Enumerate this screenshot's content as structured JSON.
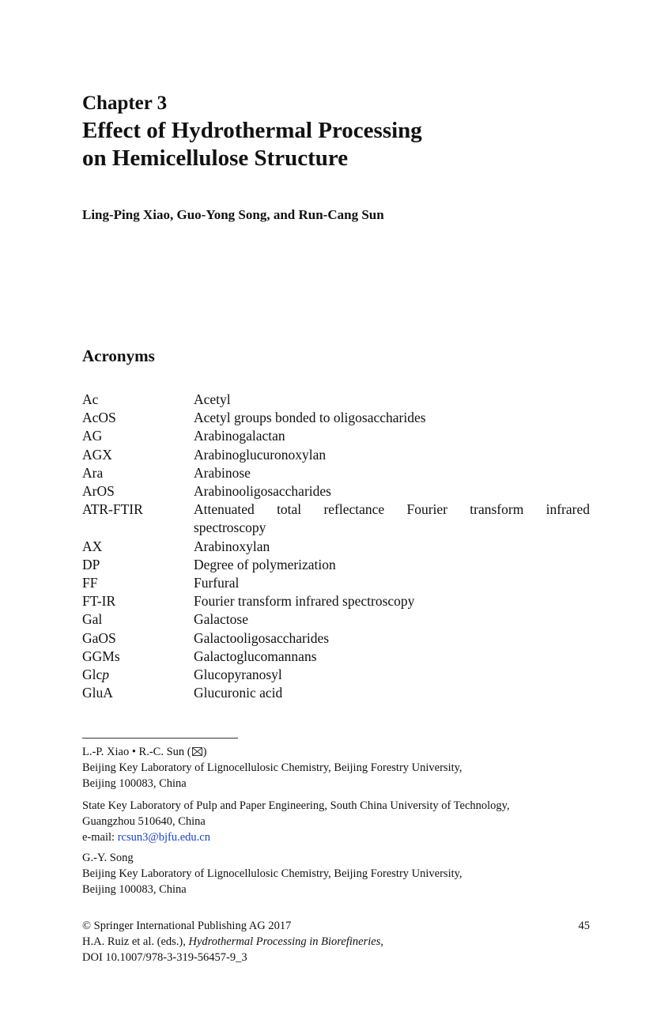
{
  "chapter": {
    "label": "Chapter 3",
    "title_line1": "Effect of Hydrothermal Processing",
    "title_line2": "on Hemicellulose Structure",
    "authors": "Ling-Ping Xiao, Guo-Yong Song, and Run-Cang Sun"
  },
  "acronyms": {
    "heading": "Acronyms",
    "items": [
      {
        "abbr": "Ac",
        "def": "Acetyl"
      },
      {
        "abbr": "AcOS",
        "def": "Acetyl groups bonded to oligosaccharides"
      },
      {
        "abbr": "AG",
        "def": "Arabinogalactan"
      },
      {
        "abbr": "AGX",
        "def": "Arabinoglucuronoxylan"
      },
      {
        "abbr": "Ara",
        "def": "Arabinose"
      },
      {
        "abbr": "ArOS",
        "def": "Arabinooligosaccharides"
      },
      {
        "abbr": "ATR-FTIR",
        "def_line1": "Attenuated total reflectance Fourier transform infrared",
        "def_line2": "spectroscopy"
      },
      {
        "abbr": "AX",
        "def": "Arabinoxylan"
      },
      {
        "abbr": "DP",
        "def": "Degree of polymerization"
      },
      {
        "abbr": "FF",
        "def": "Furfural"
      },
      {
        "abbr": "FT-IR",
        "def": "Fourier transform infrared spectroscopy"
      },
      {
        "abbr": "Gal",
        "def": "Galactose"
      },
      {
        "abbr": "GaOS",
        "def": "Galactooligosaccharides"
      },
      {
        "abbr": "GGMs",
        "def": "Galactoglucomannans"
      },
      {
        "abbr_prefix": "Glc",
        "abbr_italic": "p",
        "def": "Glucopyranosyl"
      },
      {
        "abbr": "GluA",
        "def": "Glucuronic acid"
      }
    ]
  },
  "affiliations": {
    "block1": {
      "names": "L.-P. Xiao • R.-C. Sun (",
      "names_close": ")",
      "line1": "Beijing Key Laboratory of Lignocellulosic Chemistry, Beijing Forestry University,",
      "line2": "Beijing 100083, China"
    },
    "block2": {
      "line1": "State Key Laboratory of Pulp and Paper Engineering, South China University of Technology,",
      "line2": "Guangzhou 510640, China",
      "email_label": "e-mail: ",
      "email": "rcsun3@bjfu.edu.cn"
    },
    "block3": {
      "names": "G.-Y. Song",
      "line1": "Beijing Key Laboratory of Lignocellulosic Chemistry, Beijing Forestry University,",
      "line2": "Beijing 100083, China"
    }
  },
  "footer": {
    "copyright": "© Springer International Publishing AG 2017",
    "page_number": "45",
    "citation_prefix": "H.A. Ruiz et al. (eds.), ",
    "book_title": "Hydrothermal Processing in Biorefineries",
    "citation_suffix": ",",
    "doi": "DOI 10.1007/978-3-319-56457-9_3"
  },
  "colors": {
    "text": "#111111",
    "link": "#1a3fcf"
  }
}
